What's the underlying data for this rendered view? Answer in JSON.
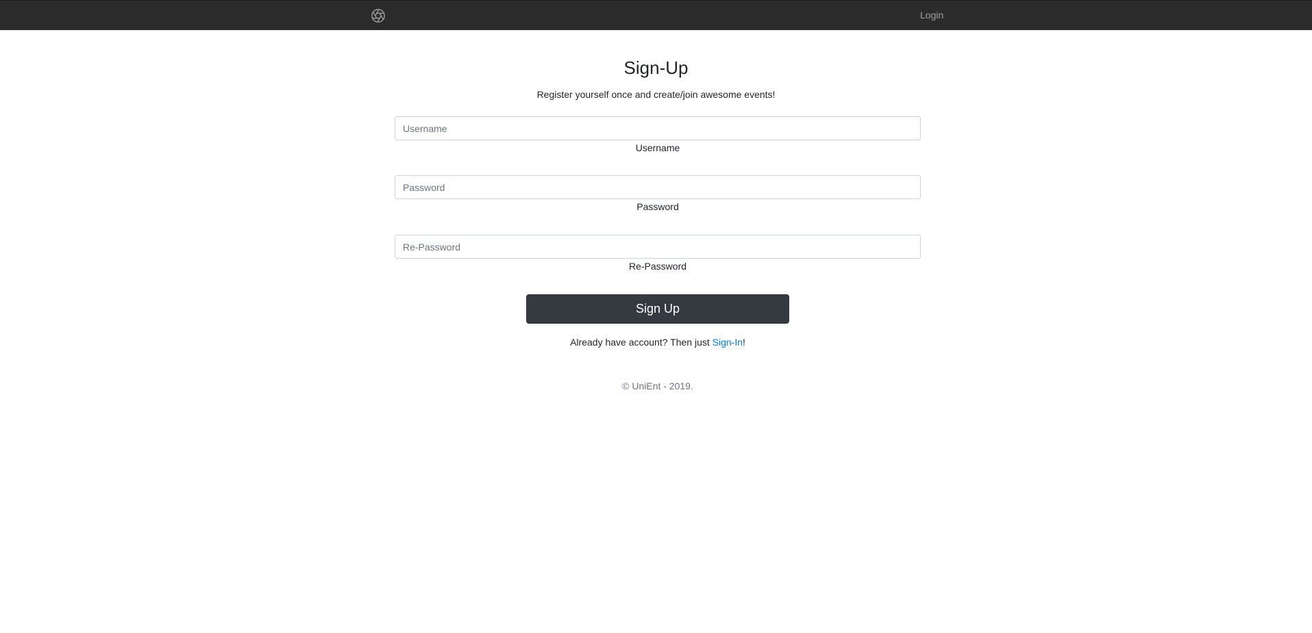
{
  "navbar": {
    "logo_icon": "aperture-icon",
    "login_label": "Login"
  },
  "form": {
    "title": "Sign-Up",
    "subtitle": "Register yourself once and create/join awesome events!",
    "fields": [
      {
        "placeholder": "Username",
        "label": "Username",
        "value": ""
      },
      {
        "placeholder": "Password",
        "label": "Password",
        "value": ""
      },
      {
        "placeholder": "Re-Password",
        "label": "Re-Password",
        "value": ""
      }
    ],
    "submit_label": "Sign Up",
    "signin_prefix": "Already have account? Then just ",
    "signin_link": "Sign-In",
    "signin_suffix": "!"
  },
  "footer": {
    "copyright": "© UniEnt - 2019."
  },
  "colors": {
    "navbar_bg": "#2b2b2b",
    "button_bg": "#343a40",
    "link": "#007bff"
  }
}
